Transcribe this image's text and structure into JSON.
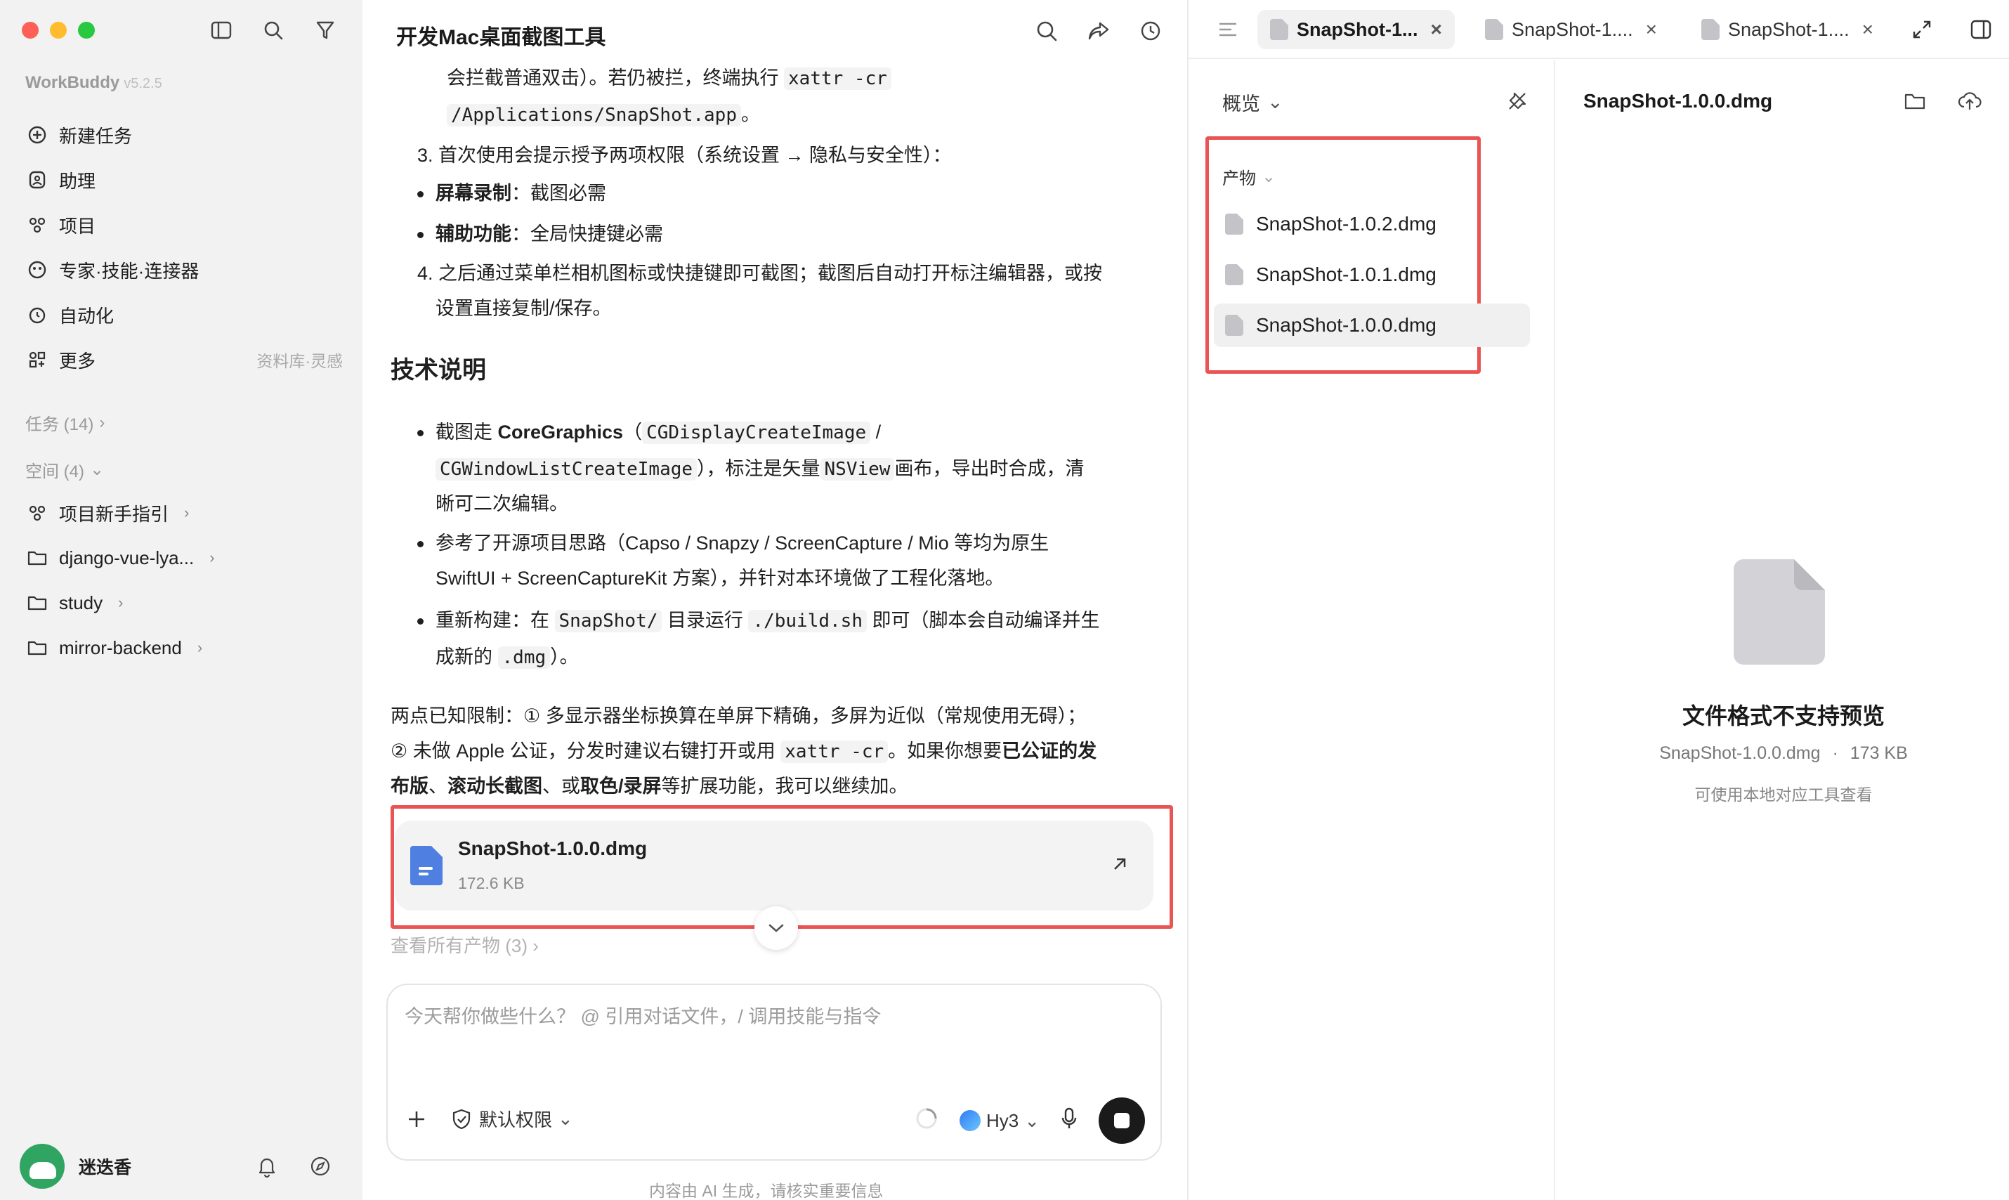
{
  "sidebar": {
    "brand": "WorkBuddy",
    "version": "v5.2.5",
    "nav": [
      {
        "label": "新建任务",
        "icon": "plus-circle-icon"
      },
      {
        "label": "助理",
        "icon": "assistant-icon"
      },
      {
        "label": "项目",
        "icon": "project-icon"
      },
      {
        "label": "专家·技能·连接器",
        "icon": "expert-icon"
      },
      {
        "label": "自动化",
        "icon": "alarm-clock-icon"
      },
      {
        "label": "更多",
        "icon": "grid-icon",
        "extra": "资料库·灵感"
      }
    ],
    "tasks_label": "任务 (14)",
    "spaces_label": "空间 (4)",
    "spaces": [
      {
        "label": "项目新手指引"
      },
      {
        "label": "django-vue-lya..."
      },
      {
        "label": "study"
      },
      {
        "label": "mirror-backend"
      }
    ],
    "user_name": "迷迭香"
  },
  "chat": {
    "title": "开发Mac桌面截图工具",
    "lines": {
      "l1a": "会拦截普通双击）。若仍被拦，终端执行",
      "l1code": "xattr -cr",
      "l2code": "/Applications/SnapShot.app",
      "l2b": "。",
      "l3": "3. 首次使用会提示授予两项权限（系统设置 → 隐私与安全性）：",
      "b1label": "屏幕录制",
      "b1text": "：截图必需",
      "b2label": "辅助功能",
      "b2text": "：全局快捷键必需",
      "l4a": "4. 之后通过菜单栏相机图标或快捷键即可截图；截图后自动打开标注编辑器，或按",
      "l4b": "设置直接复制/保存。",
      "heading": "技术说明",
      "t1a": "截图走 ",
      "t1bold": "CoreGraphics",
      "t1b": "（",
      "t1code1": "CGDisplayCreateImage",
      "t1c": " /",
      "t2code": "CGWindowListCreateImage",
      "t2a": "），标注是矢量",
      "t2code2": "NSView",
      "t2b": "画布，导出时合成，清",
      "t3": "晰可二次编辑。",
      "t4": "参考了开源项目思路（Capso / Snapzy / ScreenCapture / Mio 等均为原生",
      "t5": "SwiftUI + ScreenCaptureKit 方案），并针对本环境做了工程化落地。",
      "t6a": "重新构建：在",
      "t6code": "SnapShot/",
      "t6b": "目录运行",
      "t6code2": "./build.sh",
      "t6c": "即可（脚本会自动编译并生",
      "t7a": "成新的",
      "t7code": ".dmg",
      "t7b": "）。",
      "n1": "两点已知限制：① 多显示器坐标换算在单屏下精确，多屏为近似（常规使用无碍）；",
      "n2a": "② 未做 Apple 公证，分发时建议右键打开或用",
      "n2code": "xattr -cr",
      "n2b": "。如果你想要",
      "n2bold": "已公证的发",
      "n3bold1": "布版",
      "n3a": "、",
      "n3bold2": "滚动长截图",
      "n3b": "、或",
      "n3bold3": "取色/录屏",
      "n3c": "等扩展功能，我可以继续加。"
    },
    "file_card": {
      "name": "SnapShot-1.0.0.dmg",
      "size": "172.6 KB"
    },
    "view_all": "查看所有产物 (3)",
    "composer": {
      "placeholder": "今天帮你做些什么？ @ 引用对话文件，/ 调用技能与指令",
      "permission": "默认权限",
      "model": "Hy3"
    },
    "disclaimer": "内容由 AI 生成，请核实重要信息"
  },
  "panel": {
    "tabs": [
      {
        "label": "SnapShot-1...",
        "active": true
      },
      {
        "label": "SnapShot-1....",
        "active": false
      },
      {
        "label": "SnapShot-1....",
        "active": false
      }
    ],
    "overview_label": "概览",
    "group_label": "产物",
    "files": [
      "SnapShot-1.0.2.dmg",
      "SnapShot-1.0.1.dmg",
      "SnapShot-1.0.0.dmg"
    ],
    "preview_title": "SnapShot-1.0.0.dmg",
    "pv_main": "文件格式不支持预览",
    "pv_name": "SnapShot-1.0.0.dmg",
    "pv_size": "173 KB",
    "pv_hint": "可使用本地对应工具查看"
  },
  "colors": {
    "highlight_border": "#e95454",
    "sidebar_bg": "#f2f2f2",
    "doc_icon": "#4f7fe0"
  }
}
